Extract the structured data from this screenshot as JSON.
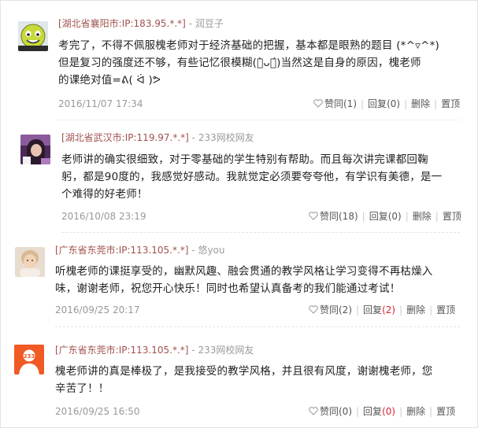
{
  "comments": [
    {
      "location_ip": "[湖北省襄阳市:IP:183.95.*.*]",
      "separator": " - ",
      "username": "润豆子",
      "lines": [
        "考完了，不得不佩服槐老师对于经济基础的把握，基本都是眼熟的题目 (*^▿^*)",
        "但是复习的强度还不够，有些记忆很模糊(ก̀ᴗก́)当然这是自身的原因，槐老师",
        "的课绝对值=ᕕ( ᐛ )ᕗ"
      ],
      "date": "2016/11/07 17:34",
      "like_label": "赞同(1)",
      "reply_label": "回复",
      "reply_count": "(0)",
      "delete_label": "删除",
      "top_label": "置顶",
      "avatar": "green-mascot-avatar"
    },
    {
      "location_ip": "[湖北省武汉市:IP:119.97.*.*]",
      "separator": " - ",
      "username": "233网校网友",
      "lines": [
        "老师讲的确实很细致，对于零基础的学生特别有帮助。而且每次讲完课都回鞠",
        "躬，都是90度的，我感觉好感动。我就觉定必须要夸夸他，有学识有美德，是一",
        "个难得的好老师！"
      ],
      "date": "2016/10/08 23:19",
      "like_label": "赞同(18)",
      "reply_label": "回复",
      "reply_count": "(0)",
      "delete_label": "删除",
      "top_label": "置顶",
      "avatar": "purple-girl-avatar"
    },
    {
      "location_ip": "[广东省东莞市:IP:113.105.*.*]",
      "separator": " - ",
      "username": "悠you",
      "lines": [
        "听槐老师的课挺享受的，幽默风趣、融会贯通的教学风格让学习变得不再枯燥入",
        "味，谢谢老师，祝您开心快乐！同时也希望认真备考的我们能通过考试！"
      ],
      "date": "2016/09/25 20:17",
      "like_label": "赞同(2)",
      "reply_label": "回复",
      "reply_count": "(2)",
      "delete_label": "删除",
      "top_label": "置顶",
      "avatar": "child-photo-avatar"
    },
    {
      "location_ip": "[广东省东莞市:IP:113.105.*.*]",
      "separator": " - ",
      "username": "233网校网友",
      "lines": [
        "槐老师讲的真是棒极了，是我接受的教学风格，并且很有风度，谢谢槐老师，您",
        "辛苦了！！"
      ],
      "date": "2016/09/25 16:50",
      "like_label": "赞同(0)",
      "reply_label": "回复",
      "reply_count": "(0)",
      "delete_label": "删除",
      "top_label": "置顶",
      "avatar": "233-logo-avatar"
    }
  ],
  "colors": {
    "location": "#a0524e",
    "username": "#9a9a9a",
    "reply_highlight": "#d9232d",
    "meta": "#999999"
  }
}
